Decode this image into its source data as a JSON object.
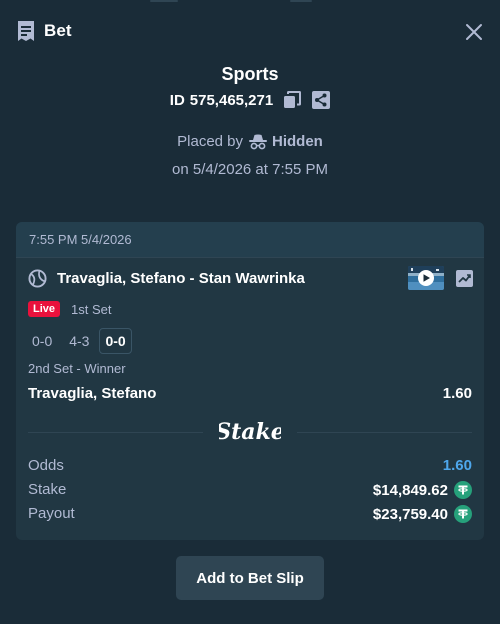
{
  "header": {
    "title": "Bet",
    "icons": {
      "bet": "receipt-icon",
      "close": "close-icon"
    }
  },
  "bet": {
    "category": "Sports",
    "id_prefix": "ID",
    "id_value": "575,465,271",
    "placed_by_label": "Placed by",
    "placed_by_user": "Hidden",
    "placed_on": "on 5/4/2026 at 7:55 PM"
  },
  "slip": {
    "time": "7:55 PM 5/4/2026",
    "match_name": "Travaglia, Stefano - Stan Wawrinka",
    "live_badge": "Live",
    "set_label": "1st Set",
    "scores": [
      "0-0",
      "4-3",
      "0-0"
    ],
    "market": "2nd Set - Winner",
    "outcome": "Travaglia, Stefano",
    "outcome_odds": "1.60",
    "brand": "Stake",
    "summary": {
      "odds_label": "Odds",
      "odds_value": "1.60",
      "stake_label": "Stake",
      "stake_value": "$14,849.62",
      "payout_label": "Payout",
      "payout_value": "$23,759.40"
    }
  },
  "actions": {
    "add_to_slip": "Add to Bet Slip"
  },
  "colors": {
    "background": "#1a2c38",
    "card": "#213743",
    "muted_text": "#b1bad3",
    "live_red": "#e9113c",
    "odds_blue": "#4ea7ec",
    "tether_green": "#26a17b",
    "button": "#2f4553"
  }
}
